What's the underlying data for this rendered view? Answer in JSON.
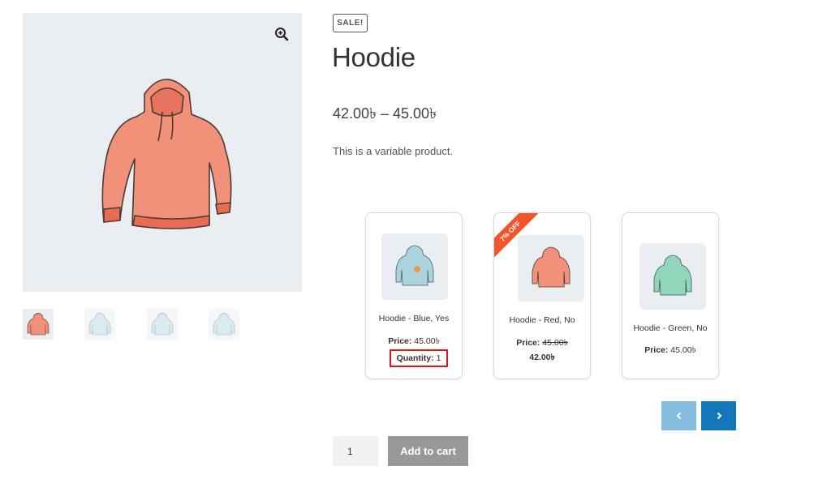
{
  "gallery": {
    "zoom_icon": "zoom-in-icon",
    "main_image_color": "#f2917a",
    "thumbnails": [
      {
        "color": "#f2917a",
        "active": true
      },
      {
        "color": "#a9d4df",
        "active": false
      },
      {
        "color": "#a9d4df",
        "active": false
      },
      {
        "color": "#a9d4df",
        "active": false
      }
    ]
  },
  "product": {
    "badge": "SALE!",
    "title": "Hoodie",
    "price_range": "42.00৳ – 45.00৳",
    "description": "This is a variable product."
  },
  "variations": [
    {
      "name": "Hoodie - Blue, Yes",
      "price_label": "Price:",
      "price": "45.00৳",
      "quantity_label": "Quantity:",
      "quantity": "1",
      "color": "#a9d4df"
    },
    {
      "name": "Hoodie - Red, No",
      "price_label": "Price:",
      "regular_price": "45.00৳",
      "sale_price": "42.00৳",
      "ribbon": "7% OFF",
      "color": "#f2917a"
    },
    {
      "name": "Hoodie - Green, No",
      "price_label": "Price:",
      "price": "45.00৳",
      "color": "#8fd6bb"
    }
  ],
  "slider": {
    "prev_icon": "chevron-left-icon",
    "next_icon": "chevron-right-icon"
  },
  "cart": {
    "quantity": "1",
    "button_label": "Add to cart"
  },
  "colors": {
    "accent": "#1277b8",
    "accent_light": "#85bde0",
    "ribbon": "#f4542a",
    "highlight": "#e0141b"
  }
}
